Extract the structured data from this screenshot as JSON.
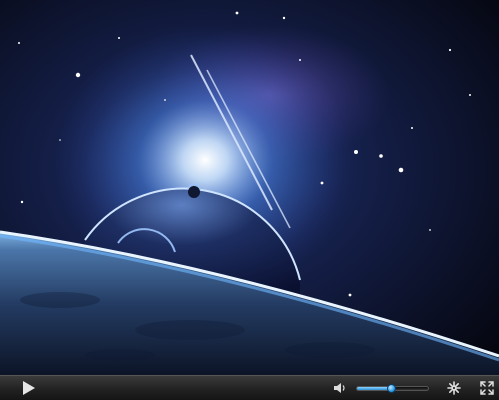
{
  "player": {
    "icons": {
      "play": "play-icon",
      "volume": "speaker-icon",
      "settings": "gear-icon",
      "fullscreen": "fullscreen-icon"
    },
    "volume_level": 0.48,
    "colors": {
      "accent": "#3aa6f0",
      "control_bar": "#2a2a2a",
      "icon": "#d8d8d8"
    }
  }
}
